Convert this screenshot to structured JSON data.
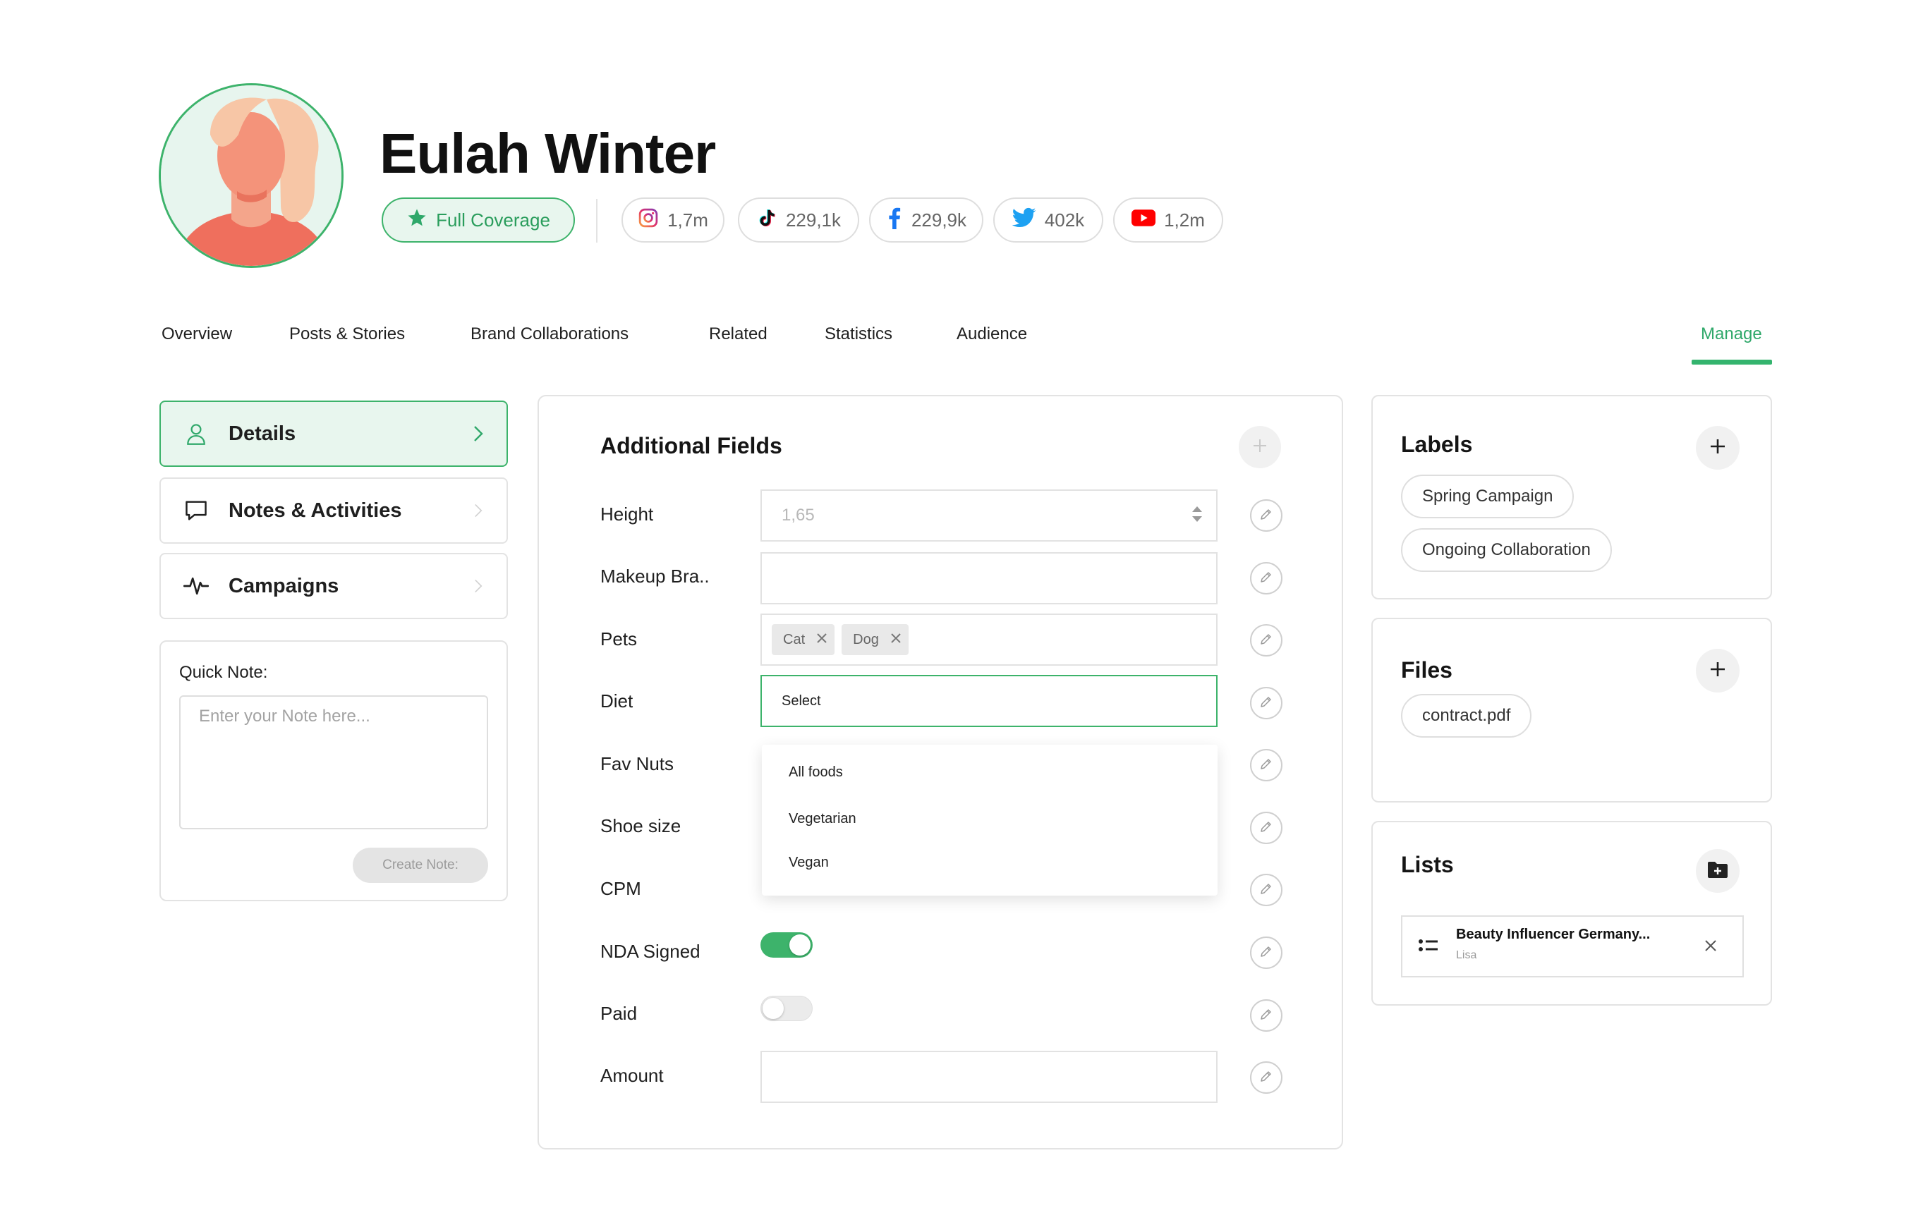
{
  "profile": {
    "name": "Eulah Winter",
    "coverage_label": "Full Coverage",
    "socials": [
      {
        "platform": "instagram",
        "icon": "instagram-icon",
        "count": "1,7m"
      },
      {
        "platform": "tiktok",
        "icon": "tiktok-icon",
        "count": "229,1k"
      },
      {
        "platform": "facebook",
        "icon": "facebook-icon",
        "count": "229,9k"
      },
      {
        "platform": "twitter",
        "icon": "twitter-icon",
        "count": "402k"
      },
      {
        "platform": "youtube",
        "icon": "youtube-icon",
        "count": "1,2m"
      }
    ]
  },
  "tabs": [
    {
      "label": "Overview"
    },
    {
      "label": "Posts & Stories"
    },
    {
      "label": "Brand Collaborations"
    },
    {
      "label": "Related"
    },
    {
      "label": "Statistics"
    },
    {
      "label": "Audience"
    },
    {
      "label": "Manage",
      "active": true
    }
  ],
  "sidebar": {
    "items": [
      {
        "label": "Details",
        "icon": "user-icon",
        "active": true
      },
      {
        "label": "Notes & Activities",
        "icon": "comment-icon"
      },
      {
        "label": "Campaigns",
        "icon": "activity-icon"
      }
    ],
    "quick_note": {
      "label": "Quick Note:",
      "placeholder": "Enter your Note here...",
      "button": "Create Note:"
    }
  },
  "additional_fields": {
    "title": "Additional Fields",
    "fields": {
      "height": {
        "label": "Height",
        "value": "1,65"
      },
      "makeup_brand": {
        "label": "Makeup Bra..",
        "value": ""
      },
      "pets": {
        "label": "Pets",
        "chips": [
          "Cat",
          "Dog"
        ]
      },
      "diet": {
        "label": "Diet",
        "value": "Select",
        "options": [
          "All foods",
          "Vegetarian",
          "Vegan"
        ]
      },
      "fav_nuts": {
        "label": "Fav Nuts"
      },
      "shoe_size": {
        "label": "Shoe size"
      },
      "cpm": {
        "label": "CPM"
      },
      "nda_signed": {
        "label": "NDA Signed",
        "on": true
      },
      "paid": {
        "label": "Paid",
        "on": false
      },
      "amount": {
        "label": "Amount",
        "value": ""
      }
    }
  },
  "labels": {
    "title": "Labels",
    "items": [
      "Spring Campaign",
      "Ongoing Collaboration"
    ]
  },
  "files": {
    "title": "Files",
    "items": [
      "contract.pdf"
    ]
  },
  "lists": {
    "title": "Lists",
    "items": [
      {
        "title": "Beauty Influencer Germany...",
        "owner": "Lisa"
      }
    ]
  },
  "colors": {
    "accent": "#34b46e",
    "accent_light": "#e8f6ee",
    "border": "#e3e3e3"
  }
}
